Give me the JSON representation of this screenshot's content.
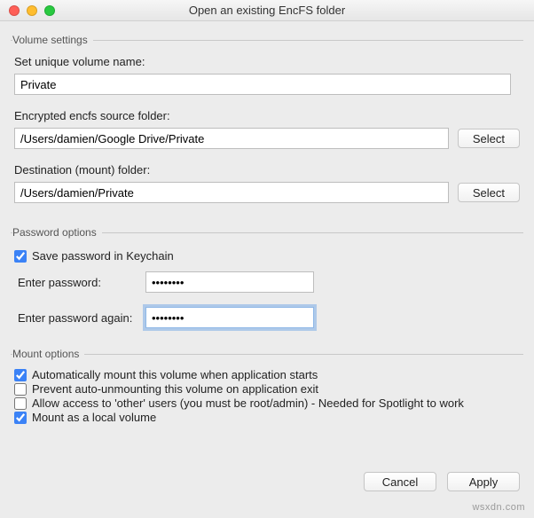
{
  "window": {
    "title": "Open an existing EncFS folder"
  },
  "volume": {
    "legend": "Volume settings",
    "name_label": "Set unique volume name:",
    "name_value": "Private",
    "source_label": "Encrypted encfs source folder:",
    "source_value": "/Users/damien/Google Drive/Private",
    "dest_label": "Destination (mount) folder:",
    "dest_value": "/Users/damien/Private",
    "select_label": "Select"
  },
  "password": {
    "legend": "Password options",
    "save_label": "Save password in Keychain",
    "save_checked": true,
    "enter_label": "Enter password:",
    "enter_value": "••••••••",
    "again_label": "Enter password again:",
    "again_value": "••••••••"
  },
  "mount": {
    "legend": "Mount options",
    "auto_label": "Automatically mount this volume when application starts",
    "auto_checked": true,
    "prevent_label": "Prevent auto-unmounting this volume on application exit",
    "prevent_checked": false,
    "other_label": "Allow access to 'other' users (you must be root/admin) - Needed for Spotlight to work",
    "other_checked": false,
    "local_label": "Mount as a local volume",
    "local_checked": true
  },
  "footer": {
    "cancel": "Cancel",
    "apply": "Apply"
  },
  "watermark": "wsxdn.com"
}
